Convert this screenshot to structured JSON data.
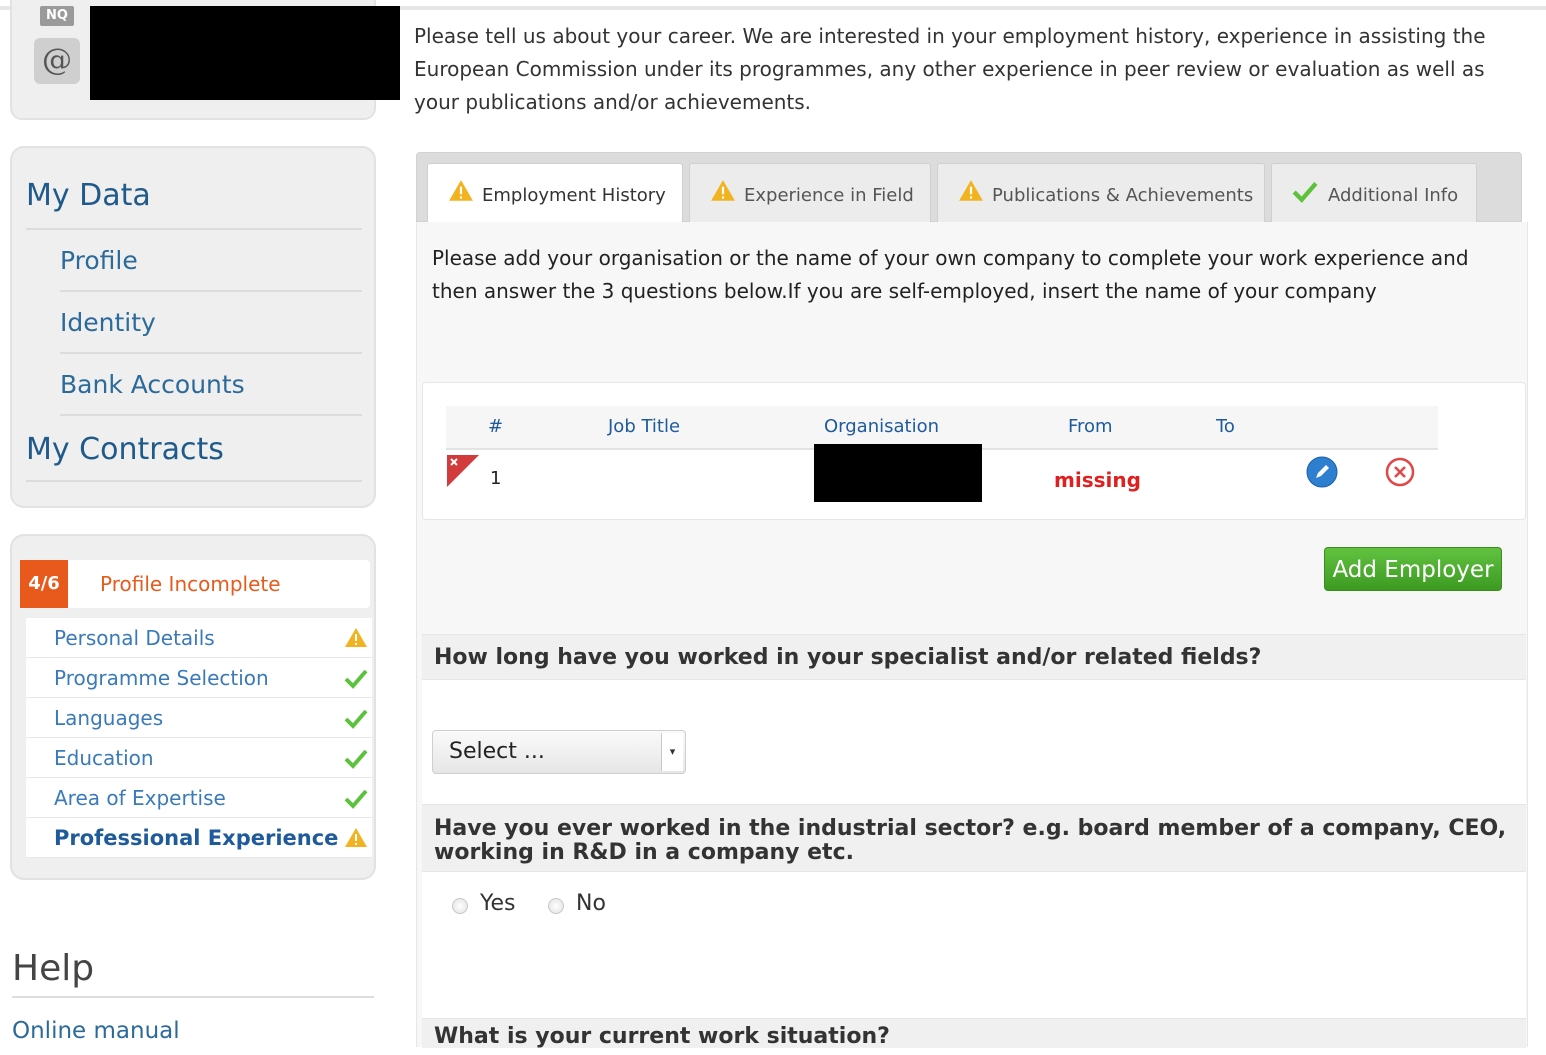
{
  "sidebar": {
    "user": {
      "nq_icon": "NQ",
      "at_icon": "@"
    },
    "nav": {
      "my_data": "My Data",
      "items": [
        "Profile",
        "Identity",
        "Bank Accounts"
      ],
      "my_contracts": "My Contracts"
    },
    "status": {
      "badge": "4/6",
      "label": "Profile Incomplete",
      "steps": [
        {
          "label": "Personal Details",
          "state": "warning"
        },
        {
          "label": "Programme Selection",
          "state": "complete"
        },
        {
          "label": "Languages",
          "state": "complete"
        },
        {
          "label": "Education",
          "state": "complete"
        },
        {
          "label": "Area of Expertise",
          "state": "complete"
        },
        {
          "label": "Professional Experience",
          "state": "warning"
        }
      ]
    },
    "help": {
      "title": "Help",
      "online_manual": "Online manual"
    }
  },
  "main": {
    "intro": "Please tell us about your career. We are interested in your employment history, experience in assisting the European Commission under its programmes, any other experience in peer review or evaluation as well as your publications and/or achievements.",
    "tabs": [
      {
        "label": "Employment History",
        "state": "warning"
      },
      {
        "label": "Experience in Field",
        "state": "warning"
      },
      {
        "label": "Publications & Achievements",
        "state": "warning"
      },
      {
        "label": "Additional Info",
        "state": "complete"
      }
    ],
    "panel_intro": "Please add your organisation or the name of your own company to complete your work experience and then answer the 3 questions below.If you are self-employed, insert the name of your company",
    "table": {
      "headers": [
        "#",
        "Job Title",
        "Organisation",
        "From",
        "To"
      ],
      "rows": [
        {
          "num": "1",
          "from": "missing"
        }
      ]
    },
    "add_employer": "Add Employer",
    "q1": {
      "text": "How long have you worked in your specialist and/or related fields?",
      "select_value": "Select ..."
    },
    "q2": {
      "text": "Have you ever worked in the industrial sector? e.g. board member of a company, CEO, working in R&D in a company etc.",
      "yes": "Yes",
      "no": "No"
    },
    "q3": {
      "text": "What is your current work situation?"
    }
  },
  "colors": {
    "accent_blue": "#1f5a8a",
    "warning_orange": "#e85a1c",
    "success_green": "#3c9a22",
    "error_red": "#e02020"
  }
}
